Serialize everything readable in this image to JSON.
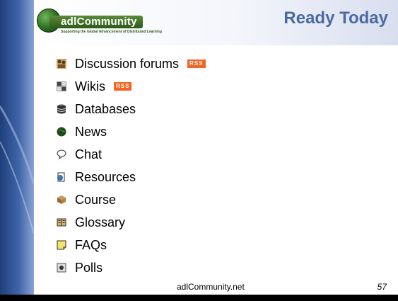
{
  "header": {
    "logo_text": "adlCommunity",
    "logo_tagline": "Supporting the Global Advancement of Distributed Learning",
    "title": "Ready Today"
  },
  "items": [
    {
      "label": "Discussion forums",
      "icon": "forum-icon",
      "rss": "RSS"
    },
    {
      "label": "Wikis",
      "icon": "wiki-icon",
      "rss": "RSS"
    },
    {
      "label": "Databases",
      "icon": "database-icon"
    },
    {
      "label": "News",
      "icon": "globe-icon"
    },
    {
      "label": "Chat",
      "icon": "chat-icon"
    },
    {
      "label": "Resources",
      "icon": "resource-icon"
    },
    {
      "label": "Course",
      "icon": "course-box-icon"
    },
    {
      "label": "Glossary",
      "icon": "glossary-book-icon"
    },
    {
      "label": "FAQs",
      "icon": "faq-note-icon"
    },
    {
      "label": "Polls",
      "icon": "poll-icon"
    }
  ],
  "footer": {
    "site": "adlCommunity.net",
    "page_number": "57"
  },
  "colors": {
    "title": "#4a6aa3",
    "rss_badge": "#f26522",
    "left_band": "#2e4f8f"
  }
}
